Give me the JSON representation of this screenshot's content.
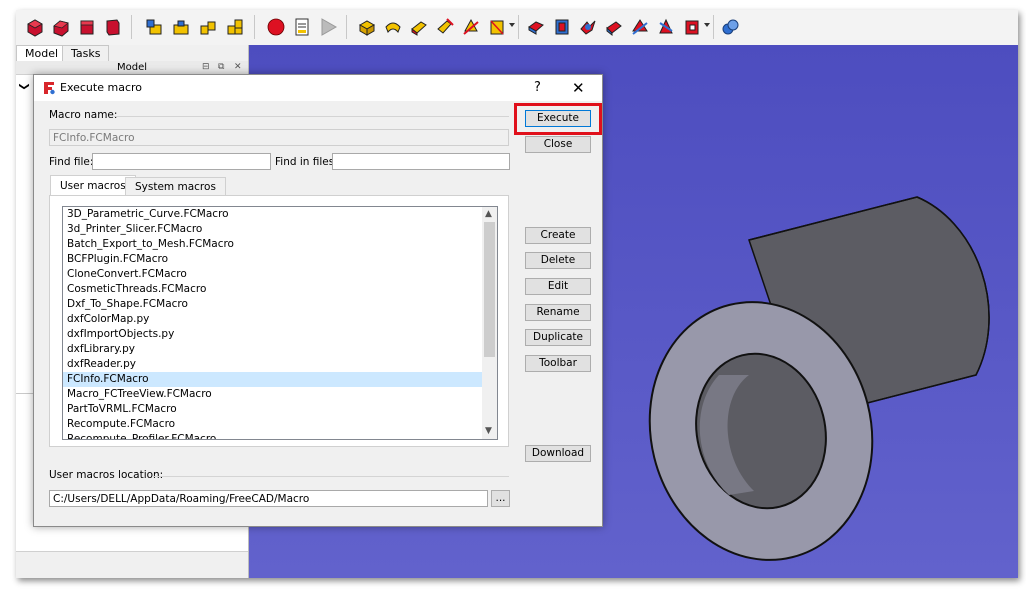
{
  "left_panel": {
    "tabs": [
      "Model",
      "Tasks"
    ],
    "active_tab": 0,
    "header_title": "Model",
    "header_buttons": [
      "⊟",
      "⧉",
      "✕"
    ],
    "tree_arrow": "❯"
  },
  "dialog": {
    "title": "Execute macro",
    "help_symbol": "?",
    "close_symbol": "✕",
    "macro_name_label": "Macro name:",
    "macro_name_value": "FCInfo.FCMacro",
    "find_file_label": "Find file:",
    "find_file_value": "",
    "find_in_files_label": "Find in files:",
    "find_in_files_value": "",
    "tabs": [
      "User macros",
      "System macros"
    ],
    "active_tab": 0,
    "macros": [
      "3D_Parametric_Curve.FCMacro",
      "3d_Printer_Slicer.FCMacro",
      "Batch_Export_to_Mesh.FCMacro",
      "BCFPlugin.FCMacro",
      "CloneConvert.FCMacro",
      "CosmeticThreads.FCMacro",
      "Dxf_To_Shape.FCMacro",
      "dxfColorMap.py",
      "dxfImportObjects.py",
      "dxfLibrary.py",
      "dxfReader.py",
      "FCInfo.FCMacro",
      "Macro_FCTreeView.FCMacro",
      "PartToVRML.FCMacro",
      "Recompute.FCMacro",
      "Recompute_Profiler.FCMacro"
    ],
    "selected_macro_index": 11,
    "location_label": "User macros location:",
    "location_value": "C:/Users/DELL/AppData/Roaming/FreeCAD/Macro",
    "browse_label": "...",
    "buttons": {
      "execute": "Execute",
      "close": "Close",
      "create": "Create",
      "delete": "Delete",
      "edit": "Edit",
      "rename": "Rename",
      "duplicate": "Duplicate",
      "toolbar": "Toolbar",
      "download": "Download"
    }
  },
  "colors": {
    "highlight_border": "#e0101b",
    "viewport_bg": "#5a5ac8",
    "selection_bg": "#cce8ff"
  }
}
